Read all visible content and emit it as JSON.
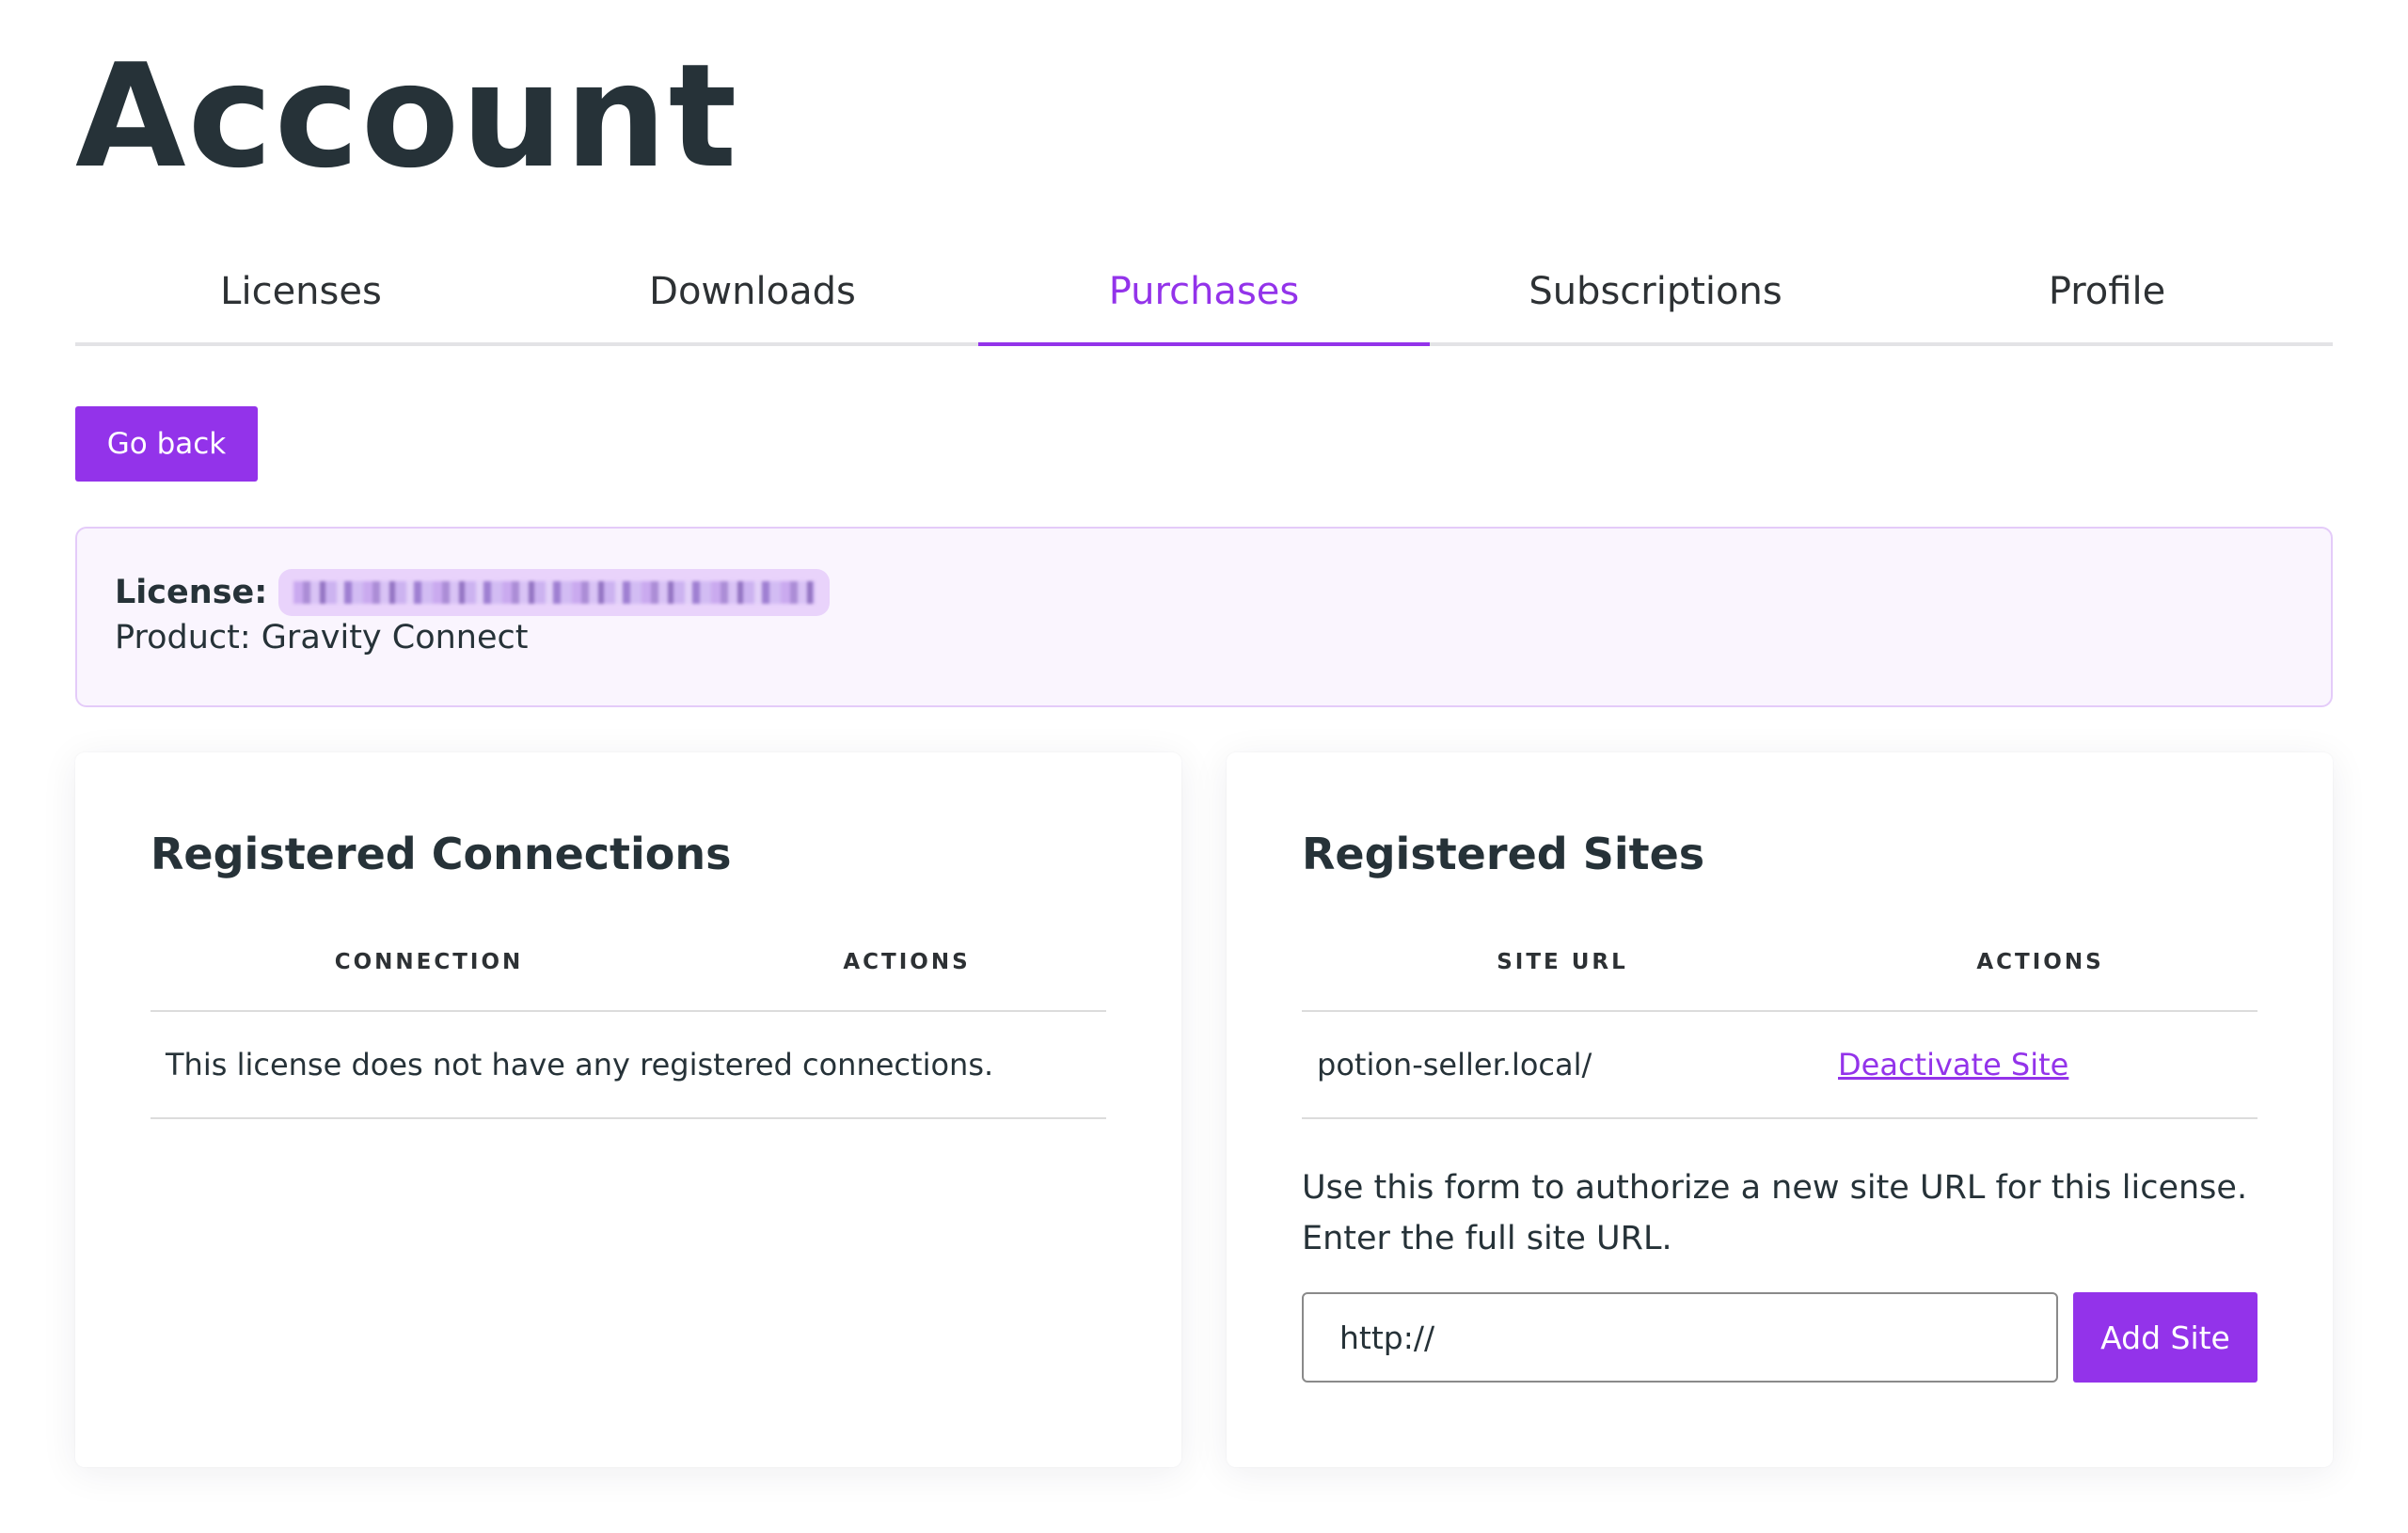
{
  "page": {
    "title": "Account"
  },
  "tabs": [
    {
      "label": "Licenses"
    },
    {
      "label": "Downloads"
    },
    {
      "label": "Purchases",
      "active": true
    },
    {
      "label": "Subscriptions"
    },
    {
      "label": "Profile"
    }
  ],
  "actions": {
    "go_back_label": "Go back"
  },
  "license_info": {
    "license_label": "License:",
    "license_key_obscured": true,
    "product_text": "Product: Gravity Connect"
  },
  "connections": {
    "title": "Registered Connections",
    "columns": [
      "CONNECTION",
      "ACTIONS"
    ],
    "empty_message": "This license does not have any registered connections."
  },
  "sites": {
    "title": "Registered Sites",
    "columns": [
      "SITE URL",
      "ACTIONS"
    ],
    "rows": [
      {
        "url": "potion-seller.local/",
        "action": "Deactivate Site"
      }
    ],
    "form_description_1": "Use this form to authorize a new site URL for this license.",
    "form_description_2": "Enter the full site URL.",
    "input_value": "http://",
    "add_button_label": "Add Site"
  },
  "colors": {
    "accent": "#9333ea",
    "text": "#263238",
    "license_bg": "#faf5fe",
    "license_border": "#e4cbf9"
  }
}
